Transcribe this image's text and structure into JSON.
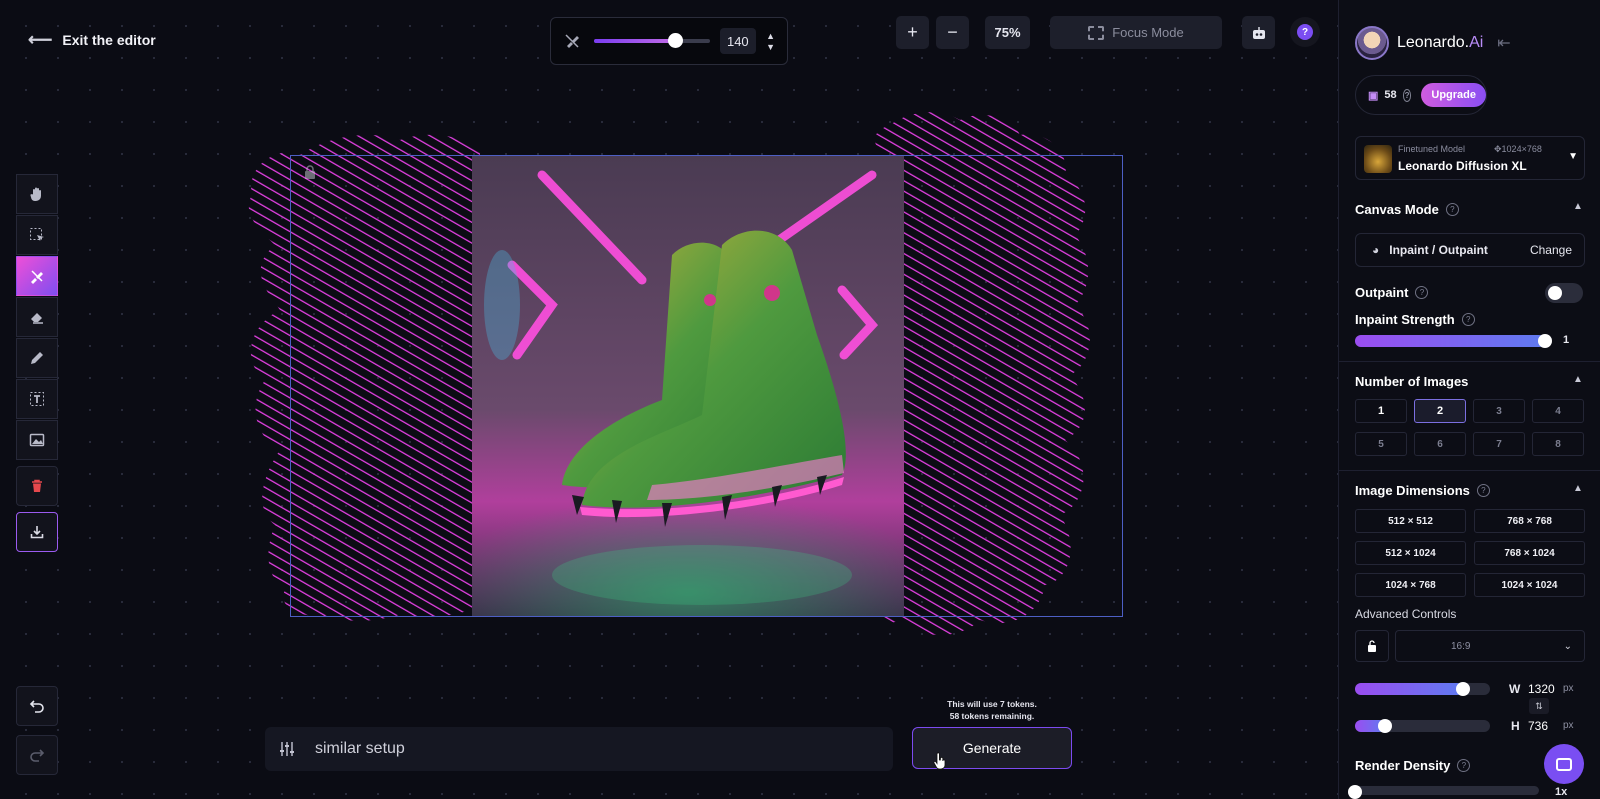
{
  "header": {
    "exit_label": "Exit the editor"
  },
  "brush": {
    "size": "140",
    "fraction": 0.7
  },
  "zoom": {
    "plus": "+",
    "minus": "−",
    "level": "75%"
  },
  "focus_mode_label": "Focus Mode",
  "prompt": {
    "text": "similar setup"
  },
  "generate": {
    "label": "Generate",
    "note_line1": "This will use 7 tokens.",
    "note_line2": "58 tokens remaining."
  },
  "panel": {
    "brand_main": "Leonardo.",
    "brand_suffix": "Ai",
    "tokens": "58",
    "upgrade_label": "Upgrade",
    "model": {
      "kind": "Finetuned Model",
      "dims": "1024×768",
      "name": "Leonardo Diffusion XL"
    },
    "canvas_mode": {
      "title": "Canvas Mode",
      "mode": "Inpaint / Outpaint",
      "change_label": "Change"
    },
    "outpaint": {
      "title": "Outpaint",
      "enabled": false
    },
    "inpaint_strength": {
      "title": "Inpaint Strength",
      "value": "1",
      "fraction": 1.0
    },
    "number_of_images": {
      "title": "Number of Images",
      "options": [
        "1",
        "2",
        "3",
        "4",
        "5",
        "6",
        "7",
        "8"
      ],
      "selected": "2"
    },
    "image_dimensions": {
      "title": "Image Dimensions",
      "options": [
        "512 × 512",
        "768 × 768",
        "512 × 1024",
        "768 × 1024",
        "1024 × 768",
        "1024 × 1024"
      ]
    },
    "advanced": {
      "title": "Advanced Controls",
      "ratio": "16:9",
      "w_label": "W",
      "w_value": "1320",
      "w_fraction": 0.8,
      "h_label": "H",
      "h_value": "736",
      "h_fraction": 0.22,
      "unit": "px"
    },
    "render_density": {
      "title": "Render Density",
      "value": "1x",
      "fraction": 0.0
    }
  },
  "colors": {
    "accent": "#7b4df2",
    "mask": "#e040e0",
    "background": "#0b0c14"
  }
}
